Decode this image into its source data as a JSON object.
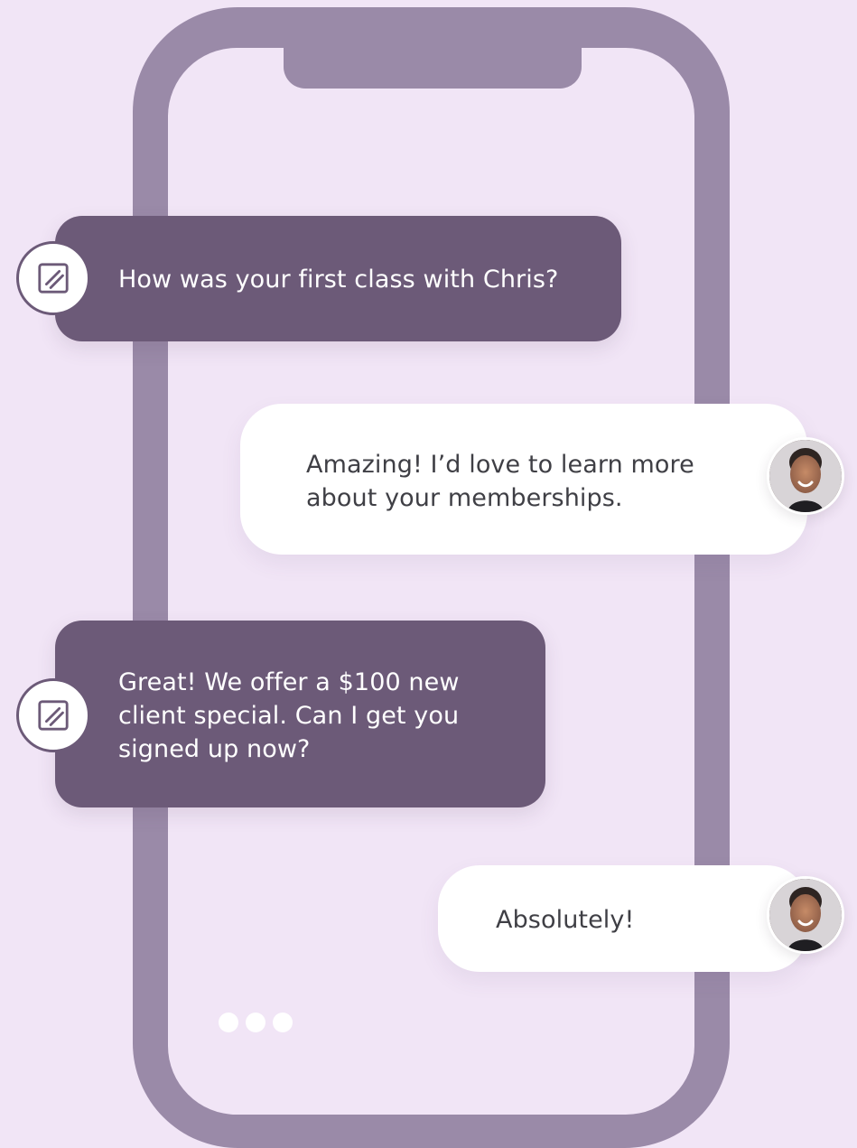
{
  "conversation": {
    "messages": [
      {
        "sender": "brand",
        "text": "How was your first class with Chris?"
      },
      {
        "sender": "client",
        "text": "Amazing! I’d love to learn more about your memberships."
      },
      {
        "sender": "brand",
        "text": "Great! We offer a $100 new client special. Can I get you signed up now?"
      },
      {
        "sender": "client",
        "text": "Absolutely!"
      }
    ]
  },
  "icons": {
    "brand_avatar": "brand-logo-icon",
    "client_avatar": "client-avatar",
    "typing": "typing-indicator"
  },
  "colors": {
    "background": "#f1e5f6",
    "phone_frame": "#9a8aa8",
    "brand_bubble": "#6c5a78",
    "client_bubble": "#ffffff",
    "client_text": "#3f3f45"
  }
}
